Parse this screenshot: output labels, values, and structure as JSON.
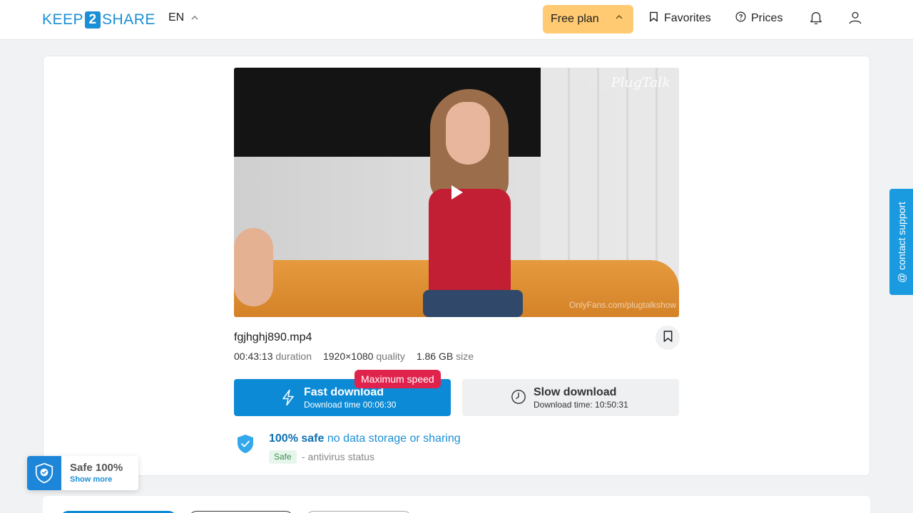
{
  "header": {
    "logo": {
      "part1": "KEEP",
      "part2": "2",
      "part3": "SHARE"
    },
    "language": "EN",
    "plan_label": "Free plan",
    "favorites_label": "Favorites",
    "prices_label": "Prices"
  },
  "video": {
    "watermark": "PlugTalk",
    "watermark_url": "OnlyFans.com/plugtalkshow"
  },
  "file": {
    "name": "fgjhghj890.mp4",
    "duration_value": "00:43:13",
    "duration_label": "duration",
    "quality_value": "1920×1080",
    "quality_label": "quality",
    "size_value": "1.86 GB",
    "size_label": "size"
  },
  "downloads": {
    "fast_title": "Fast download",
    "fast_sub": "Download time 00:06:30",
    "max_badge": "Maximum speed",
    "slow_title": "Slow download",
    "slow_sub": "Download time: 10:50:31"
  },
  "safety": {
    "bold": "100% safe",
    "rest": " no data storage or sharing",
    "badge": "Safe",
    "antivirus": "- antivirus status"
  },
  "support_label": "@ contact support",
  "toast": {
    "title": "Safe 100%",
    "link": "Show more"
  },
  "colors": {
    "accent": "#0c8ad5",
    "plan": "#ffca72",
    "badge_red": "#e0234d"
  }
}
